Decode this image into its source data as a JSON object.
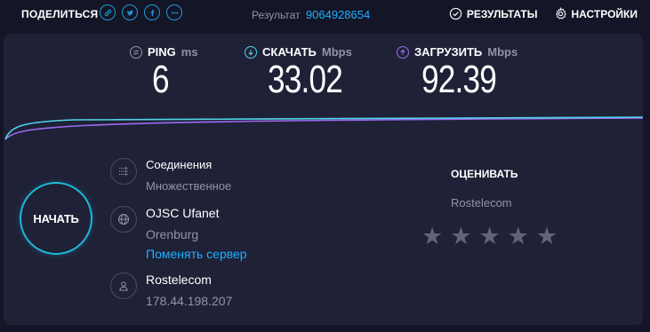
{
  "topbar": {
    "share_label": "ПОДЕЛИТЬСЯ",
    "share_icons": [
      "link-icon",
      "twitter-icon",
      "facebook-icon",
      "more-icon"
    ],
    "result_label": "Результат",
    "result_id": "9064928654",
    "results_label": "РЕЗУЛЬТАТЫ",
    "settings_label": "НАСТРОЙКИ"
  },
  "metrics": {
    "ping": {
      "label": "PING",
      "unit": "ms",
      "value": "6"
    },
    "download": {
      "label": "СКАЧАТЬ",
      "unit": "Mbps",
      "value": "33.02"
    },
    "upload": {
      "label": "ЗАГРУЗИТЬ",
      "unit": "Mbps",
      "value": "92.39"
    }
  },
  "start_button": "НАЧАТЬ",
  "connections": {
    "title": "Соединения",
    "value": "Множественное"
  },
  "server": {
    "name": "OJSC Ufanet",
    "city": "Orenburg",
    "change_link": "Поменять сервер"
  },
  "provider": {
    "name": "Rostelecom",
    "ip": "178.44.198.207"
  },
  "rating": {
    "label": "ОЦЕНИВАТЬ",
    "isp": "Rostelecom",
    "stars": 5
  },
  "colors": {
    "accent": "#1bb1ff",
    "download_line": "#4fd5e6",
    "upload_line": "#9b6cf2"
  }
}
